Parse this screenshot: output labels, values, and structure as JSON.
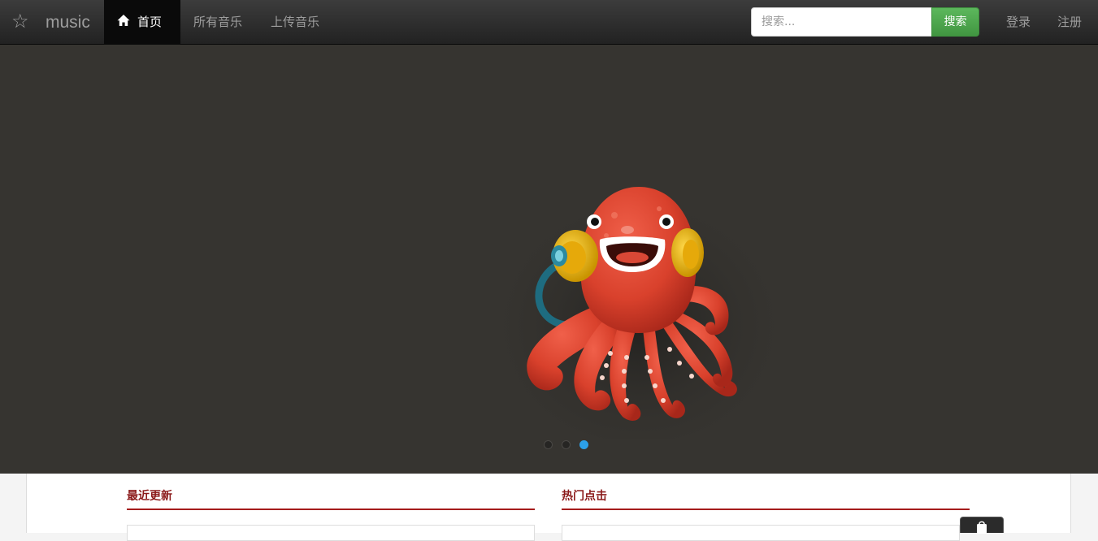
{
  "navbar": {
    "brand_icon": "star-icon",
    "brand": "music",
    "links": {
      "home": "首页",
      "all_music": "所有音乐",
      "upload": "上传音乐"
    },
    "search": {
      "placeholder": "搜索...",
      "value": "",
      "button_label": "搜索"
    },
    "login": "登录",
    "register": "注册"
  },
  "carousel": {
    "slide_image": "octopus-with-headphones",
    "slide_count": 3,
    "active_slide": 3
  },
  "sections": {
    "recent_title": "最近更新",
    "popular_title": "热门点击"
  },
  "colors": {
    "navbar_bg": "#222222",
    "active_nav_bg": "#0a0a0a",
    "search_button": "#4cae4c",
    "carousel_bg": "#363430",
    "indicator_active": "#2ca0e8",
    "section_title": "#8b1a1a"
  }
}
